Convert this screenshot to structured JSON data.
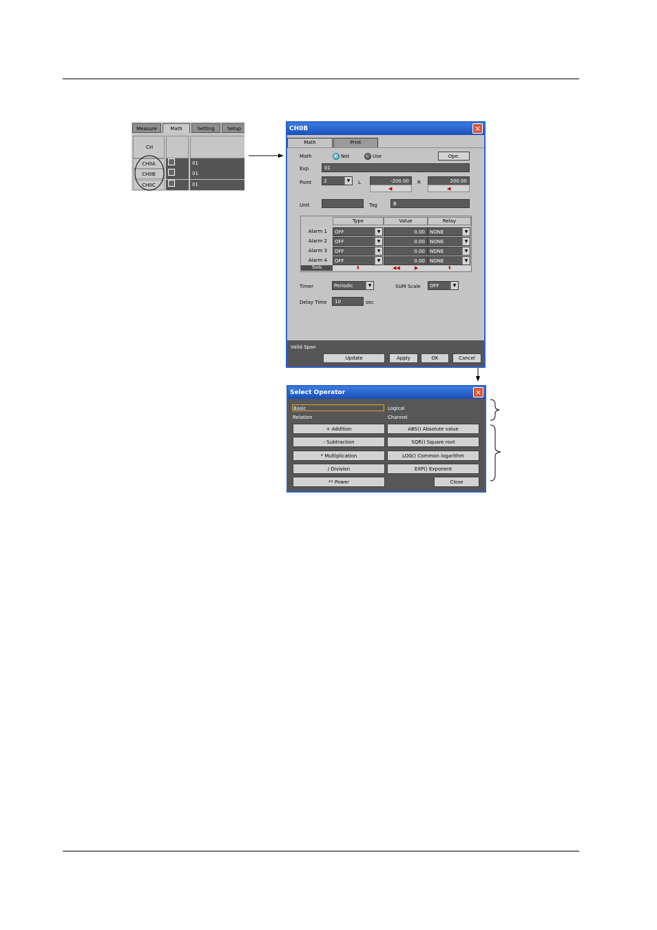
{
  "table_panel": {
    "tabs": [
      "Measure",
      "Math",
      "Setting",
      "Setup"
    ],
    "column_header": "CH",
    "rows": [
      {
        "ch": "CH0A",
        "state": "OFF",
        "value": "01"
      },
      {
        "ch": "CH0B",
        "state": "OFF",
        "value": "01"
      },
      {
        "ch": "CH0C",
        "state": "OFF",
        "value": "01"
      }
    ]
  },
  "ch_dialog": {
    "title": "CH0B",
    "close_icon": "×",
    "tabs": [
      "Math",
      "Print"
    ],
    "math_label": "Math",
    "math_options": [
      "Not",
      "Use"
    ],
    "ope_button": "Ope.",
    "expr_label": "Exp.",
    "expr_value": "01",
    "point_label": "Point",
    "point_value": "2",
    "l_label": "L",
    "l_value": "-200.00",
    "r_label": "R",
    "r_value": "200.00",
    "unit_label": "Unit",
    "unit_value": "",
    "tag_label": "Tag",
    "tag_value": "B",
    "alarm_headers": [
      "Type",
      "Value",
      "Relay"
    ],
    "alarms": [
      {
        "label": "Alarm 1",
        "type": "OFF",
        "value": "0.00",
        "relay": "NONE"
      },
      {
        "label": "Alarm 2",
        "type": "OFF",
        "value": "0.00",
        "relay": "NONE"
      },
      {
        "label": "Alarm 3",
        "type": "OFF",
        "value": "0.00",
        "relay": "NONE"
      },
      {
        "label": "Alarm 4",
        "type": "OFF",
        "value": "0.00",
        "relay": "NONE"
      }
    ],
    "tools_label": "Tools",
    "timer_label": "Timer",
    "timer_value": "Periodic",
    "sum_scale_label": "SUM Scale",
    "sum_scale_value": "OFF",
    "delay_label": "Delay Time",
    "delay_value": "10",
    "delay_unit": "sec",
    "valid_span": "Valid Span",
    "buttons": [
      "Update",
      "Apply",
      "OK",
      "Cancel"
    ]
  },
  "operator_dialog": {
    "title": "Select Operator",
    "close_icon": "×",
    "categories": [
      "Basic",
      "Logical",
      "Relation",
      "Channel"
    ],
    "operators": [
      "+ Addition",
      "ABS() Absolute value",
      "- Subtraction",
      "SQR() Square root",
      "* Multiplication",
      "LOG() Common logarithm",
      "/ Division",
      "EXP() Exponent",
      "** Power"
    ],
    "close_button": "Close"
  }
}
